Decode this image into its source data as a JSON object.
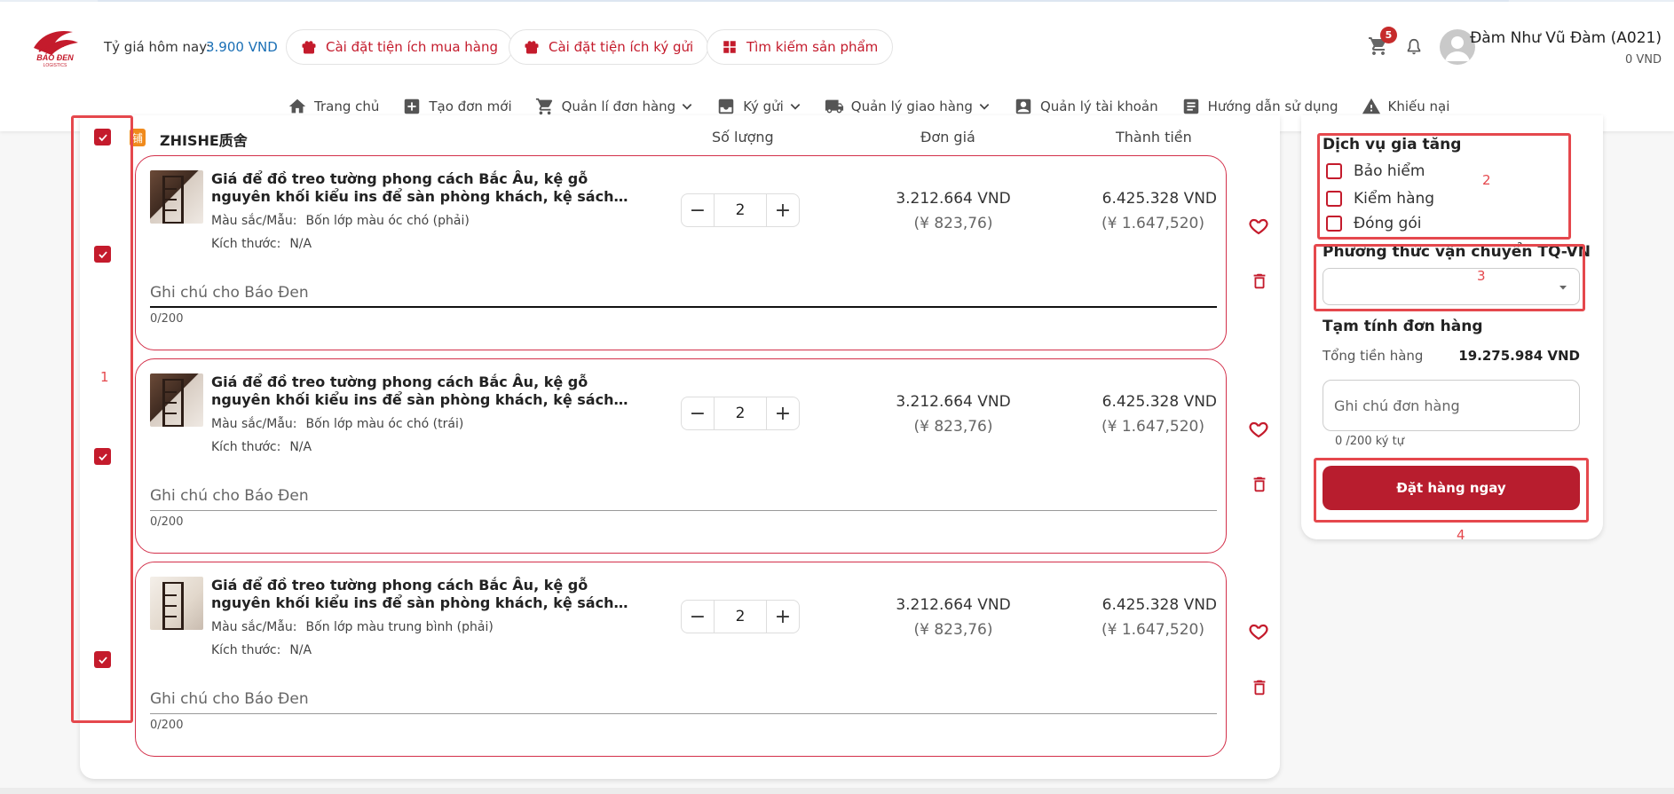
{
  "header": {
    "rate_label": "Tỷ giá hôm nay:",
    "rate_value": "3.900 VND",
    "pills": [
      {
        "label": "Cài đặt tiện ích mua hàng",
        "icon": "gift-icon"
      },
      {
        "label": "Cài đặt tiện ích ký gửi",
        "icon": "gift-icon"
      },
      {
        "label": "Tìm kiếm sản phẩm",
        "icon": "widgets-icon"
      }
    ],
    "cart_badge": "5",
    "user_name": "Đàm Như Vũ Đàm (A021)",
    "user_balance": "0 VND"
  },
  "nav": [
    {
      "label": "Trang chủ",
      "icon": "home-icon",
      "dropdown": false
    },
    {
      "label": "Tạo đơn mới",
      "icon": "add-box-icon",
      "dropdown": false
    },
    {
      "label": "Quản lí đơn hàng",
      "icon": "cart-icon",
      "dropdown": true
    },
    {
      "label": "Ký gửi",
      "icon": "consign-icon",
      "dropdown": true
    },
    {
      "label": "Quản lý giao hàng",
      "icon": "truck-icon",
      "dropdown": true
    },
    {
      "label": "Quản lý tài khoản",
      "icon": "account-icon",
      "dropdown": false
    },
    {
      "label": "Hướng dẫn sử dụng",
      "icon": "article-icon",
      "dropdown": false
    },
    {
      "label": "Khiếu nại",
      "icon": "warning-icon",
      "dropdown": false
    }
  ],
  "cart": {
    "shop_icon_text": "铺",
    "shop_name": "ZHISHE质舍",
    "col_qty": "Số lượng",
    "col_price": "Đơn giá",
    "col_total": "Thành tiền",
    "color_key": "Màu sắc/Mẫu:",
    "size_key": "Kích thước:",
    "note_placeholder": "Ghi chú cho Báo Đen",
    "note_count": "0/200",
    "items": [
      {
        "title": "Giá để đồ treo tường phong cách Bắc Âu, kệ gỗ nguyên khối kiểu ins để sàn phòng khách, kệ sách nhỏ gọn cho góc phòng",
        "color": "Bốn lớp màu óc chó (phải)",
        "size": "N/A",
        "qty": "2",
        "unit_price_vnd": "3.212.664 VND",
        "unit_price_cny": "(¥ 823,76)",
        "total_vnd": "6.425.328 VND",
        "total_cny": "(¥ 1.647,520)",
        "checked": true
      },
      {
        "title": "Giá để đồ treo tường phong cách Bắc Âu, kệ gỗ nguyên khối kiểu ins để sàn phòng khách, kệ sách nhỏ gọn cho góc phòng",
        "color": "Bốn lớp màu óc chó (trái)",
        "size": "N/A",
        "qty": "2",
        "unit_price_vnd": "3.212.664 VND",
        "unit_price_cny": "(¥ 823,76)",
        "total_vnd": "6.425.328 VND",
        "total_cny": "(¥ 1.647,520)",
        "checked": true
      },
      {
        "title": "Giá để đồ treo tường phong cách Bắc Âu, kệ gỗ nguyên khối kiểu ins để sàn phòng khách, kệ sách nhỏ gọn cho góc phòng",
        "color": "Bốn lớp màu trung bình (phải)",
        "size": "N/A",
        "qty": "2",
        "unit_price_vnd": "3.212.664 VND",
        "unit_price_cny": "(¥ 823,76)",
        "total_vnd": "6.425.328 VND",
        "total_cny": "(¥ 1.647,520)",
        "checked": true
      }
    ]
  },
  "sidebar": {
    "services_title": "Dịch vụ gia tăng",
    "services": [
      "Bảo hiểm",
      "Kiểm hàng",
      "Đóng gói"
    ],
    "shipping_title": "Phương thức vận chuyển TQ-VN",
    "shipping_value": "",
    "summary_title": "Tạm tính đơn hàng",
    "total_label": "Tổng tiền hàng",
    "total_value": "19.275.984 VND",
    "order_note_placeholder": "Ghi chú đơn hàng",
    "order_note_count": "0 /200 ký tự",
    "order_button": "Đặt hàng ngay"
  },
  "annotations": [
    "1",
    "2",
    "3",
    "4"
  ],
  "colors": {
    "brand_red": "#c41b2c",
    "annotation_red": "#e5484d",
    "rate_blue": "#1a6fb5"
  }
}
